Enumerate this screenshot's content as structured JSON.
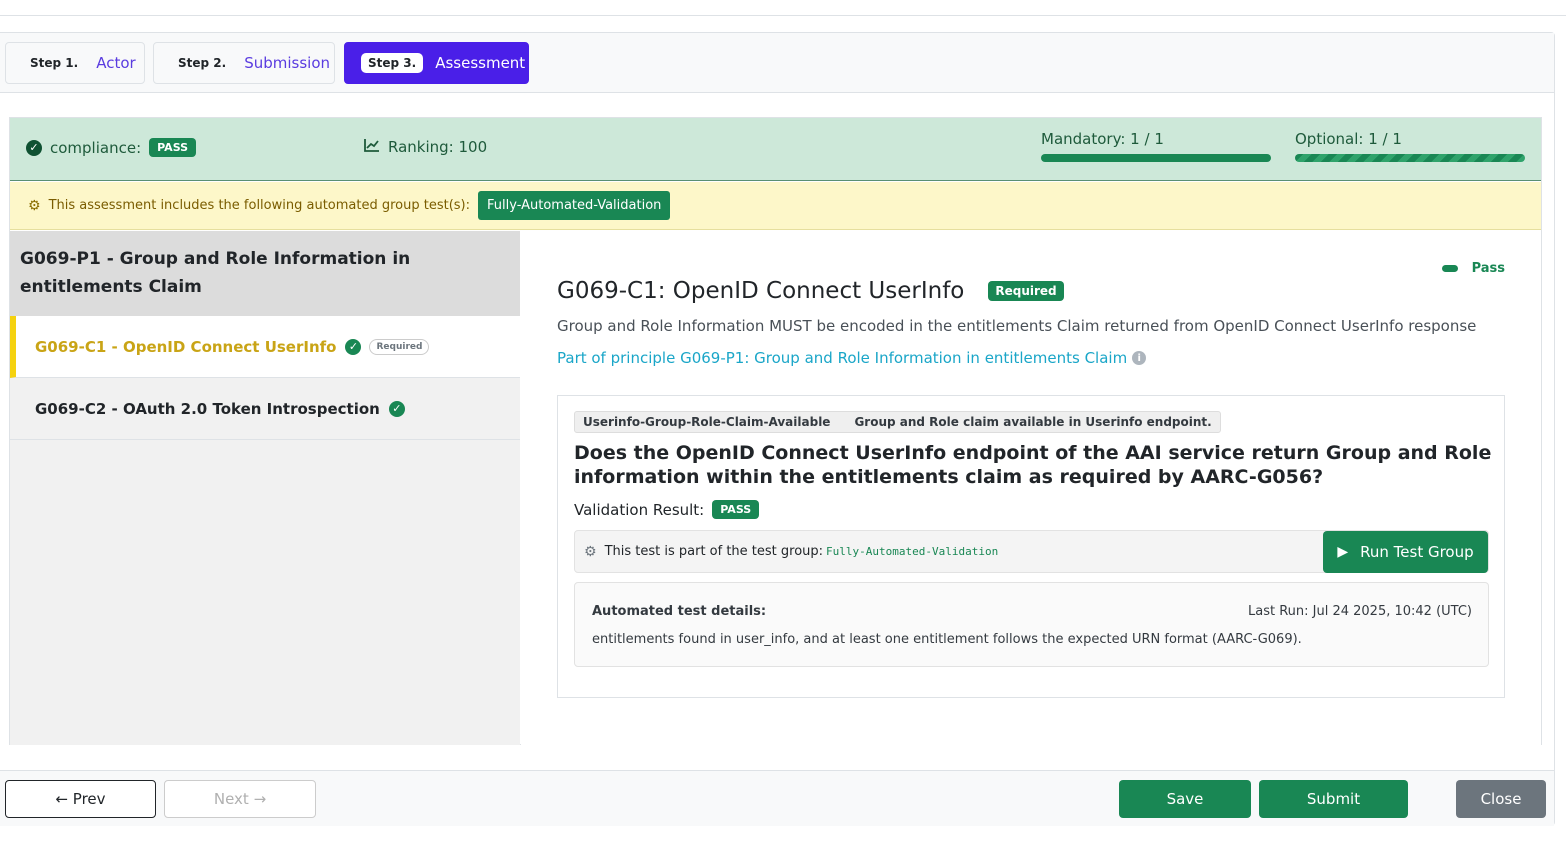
{
  "steps": [
    {
      "num": "Step 1.",
      "label": "Actor"
    },
    {
      "num": "Step 2.",
      "label": "Submission"
    },
    {
      "num": "Step 3.",
      "label": "Assessment"
    }
  ],
  "summary": {
    "compliance_label": "compliance:",
    "compliance_value": "PASS",
    "ranking": "Ranking: 100",
    "mandatory": "Mandatory: 1 / 1",
    "mandatory_fraction": 1.0,
    "optional": "Optional: 1 / 1",
    "optional_fraction": 1.0
  },
  "automated": {
    "text": "This assessment includes the following automated group test(s):",
    "group": "Fully-Automated-Validation"
  },
  "sidebar": {
    "principle": "G069-P1 - Group and Role Information in entitlements Claim",
    "criteria": [
      {
        "label": "G069-C1 - OpenID Connect UserInfo",
        "badge": "Required"
      },
      {
        "label": "G069-C2 - OAuth 2.0 Token Introspection"
      }
    ]
  },
  "main": {
    "status": "Pass",
    "title": "G069-C1: OpenID Connect UserInfo",
    "required": "Required",
    "description": "Group and Role Information MUST be encoded in the entitlements Claim returned from OpenID Connect UserInfo response",
    "principle_link": "Part of principle G069-P1: Group and Role Information in entitlements Claim",
    "test": {
      "id": "Userinfo-Group-Role-Claim-Available",
      "name": "Group and Role claim available in Userinfo endpoint.",
      "question": "Does the OpenID Connect UserInfo endpoint of the AAI service return Group and Role information within the entitlements claim as required by AARC-G056?",
      "validation_label": "Validation Result:",
      "validation_value": "PASS",
      "group_text": "This test is part of the test group:",
      "group_code": "Fully-Automated-Validation",
      "run_button": "Run Test Group",
      "details_heading": "Automated test details:",
      "last_run": "Last Run: Jul 24 2025, 10:42 (UTC)",
      "details_body": "entitlements found in user_info, and at least one entitlement follows the expected URN format (AARC-G069)."
    }
  },
  "footer": {
    "prev": "← Prev",
    "next": "Next →",
    "save": "Save",
    "submit": "Submit",
    "close": "Close"
  }
}
